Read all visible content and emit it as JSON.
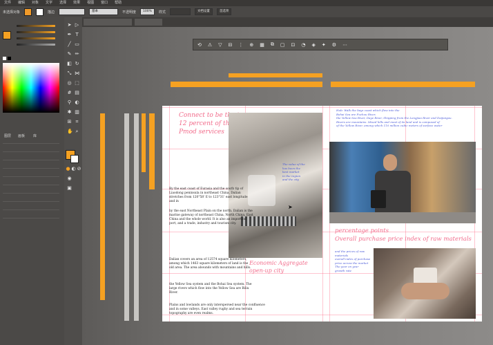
{
  "menubar": {
    "items": [
      "文件",
      "编辑",
      "对象",
      "文字",
      "选择",
      "效果",
      "视图",
      "窗口",
      "帮助"
    ]
  },
  "controlbar": {
    "label_left": "未选择对象",
    "stroke_label": "描边",
    "stroke_value": "基本",
    "opacity_label": "不透明度",
    "opacity_value": "100%",
    "style_label": "样式",
    "doc_setup": "文档设置",
    "prefs": "首选项"
  },
  "colors": {
    "accent": "#f5a122",
    "pink": "#f26d8c",
    "blue": "#4a5ad8"
  },
  "layers": {
    "labels": [
      "图层",
      "画板",
      "库"
    ]
  },
  "floatbar": {
    "icons": [
      "transform-icon",
      "align-icon",
      "pathfinder-icon",
      "envelope-icon",
      "gear-icon"
    ]
  },
  "artboard": {
    "headline": "Connect to be the top 12 percent of the Pmod services",
    "left_body": [
      "By the east coast of Eurasia and the south tip of Liaodong peninsula in northeast China, Dalian stretches from 120°58' E to 123°31' east longitude and in",
      "by the east Northeast Plain on the north. Dalian is the marine gateway of northeast China, North China, East China and the whole world. It is also an important port, and a trade, industry and tourism city.",
      "Dalian covers an area of 12574 square kilometers, among which 1463 square kilometers of land is the old area. The area abounds with mountains and hills.",
      "the Yellow Sea system and the Bohai Sea system. The large rivers which flow into the Yellow Sea are Biliu River.",
      "Plains and lowlands are only interspersed near the confluence and in some valleys. East valley rugby and sea terrain topography are even realms."
    ],
    "economic_caption": "Economic Aggregate open-up city",
    "right_top_blue": [
      "Hub: Walk the bays coast which flow into the",
      "Bohai Sea are Fuzhou River,",
      "the Yellow Sea River, Daye River, Shipping from the Longjiao River and Daijiaigou.",
      "Rivers are mountains. Mixed hills and most of its land and is composed of",
      "of the Yellow River, among which 110 million cubic meters of surface water"
    ],
    "percentage_text": "percentage points",
    "overall_text": "Overall purchase price index of raw materials",
    "mid_blue": [
      "The value of the",
      "has been the",
      "best market",
      "in the region",
      "and the city"
    ],
    "bottom_blue": [
      "and the prices of raw materials",
      "overall index of purchase",
      "price across the market",
      "The year on year",
      "growth rate"
    ]
  }
}
